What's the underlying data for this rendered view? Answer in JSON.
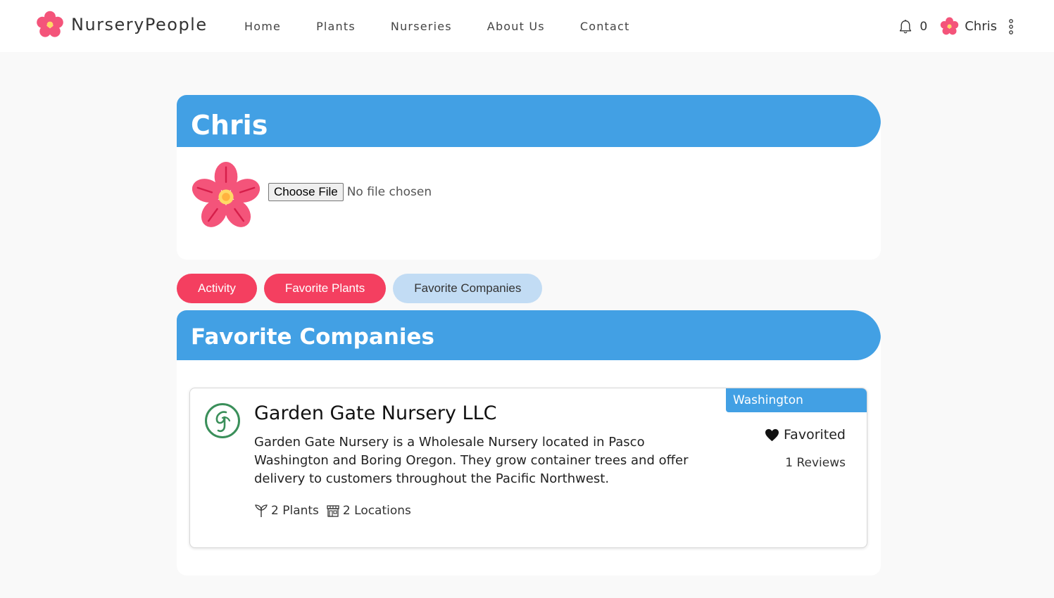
{
  "header": {
    "brand_name": "NurseryPeople",
    "nav": [
      "Home",
      "Plants",
      "Nurseries",
      "About Us",
      "Contact"
    ],
    "notification_count": "0",
    "user_name": "Chris",
    "icons": {
      "logo": "flower-logo-icon",
      "bell": "bell-icon",
      "menu": "more-vertical-icon"
    }
  },
  "profile": {
    "name": "Chris",
    "file_button": "Choose File",
    "file_status": "No file chosen"
  },
  "tabs": [
    {
      "label": "Activity",
      "active": false
    },
    {
      "label": "Favorite Plants",
      "active": false
    },
    {
      "label": "Favorite Companies",
      "active": true
    }
  ],
  "favorites": {
    "title": "Favorite Companies",
    "companies": [
      {
        "name": "Garden Gate Nursery LLC",
        "description": "Garden Gate Nursery is a Wholesale Nursery located in Pasco Washington and Boring Oregon. They grow container trees and offer delivery to customers throughout the Pacific Northwest.",
        "plants": "2 Plants",
        "locations": "2 Locations",
        "region": "Washington",
        "favorited_label": "Favorited",
        "reviews": "1 Reviews"
      }
    ]
  },
  "colors": {
    "accent_blue": "#42a0e4",
    "tab_red": "#f43f60",
    "tab_active": "#c2dcf4",
    "flower_pink": "#f4547a"
  }
}
